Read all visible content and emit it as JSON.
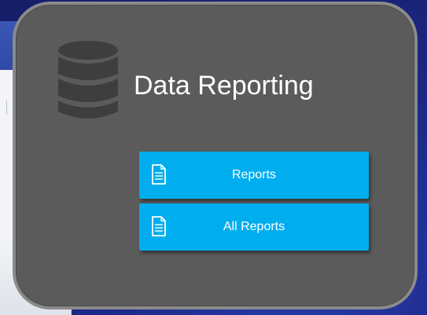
{
  "panel": {
    "title": "Data Reporting",
    "icon": "database-icon"
  },
  "menu": {
    "items": [
      {
        "label": "Reports",
        "icon": "document-icon"
      },
      {
        "label": "All Reports",
        "icon": "document-icon"
      }
    ]
  },
  "colors": {
    "panel_bg": "#5b5b5b",
    "panel_border": "#8a8a8a",
    "button_bg": "#00aeef",
    "desktop_bg": "#1d2a8a"
  }
}
